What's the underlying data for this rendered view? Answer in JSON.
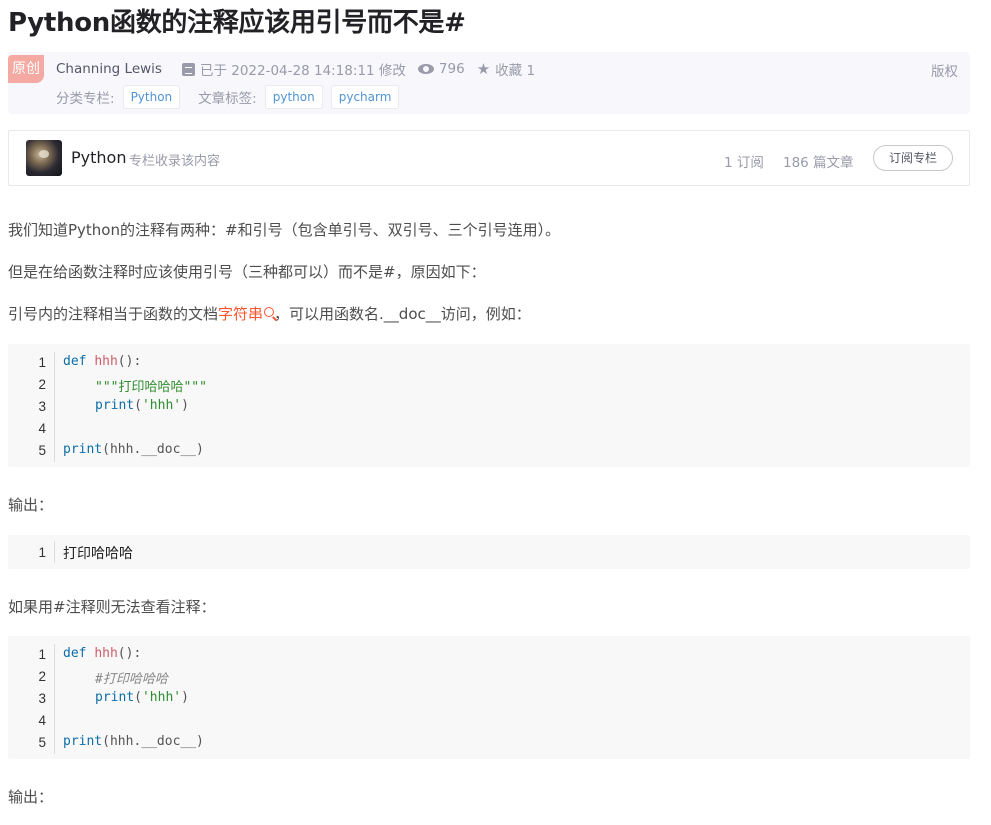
{
  "title": "Python函数的注释应该用引号而不是#",
  "meta": {
    "original_badge": "原创",
    "author": "Channing Lewis",
    "modified": "已于 2022-04-28 14:18:11 修改",
    "views": "796",
    "favorites": "收藏 1",
    "copyright": "版权",
    "category_label": "分类专栏:",
    "category_tag": "Python",
    "article_tags_label": "文章标签:",
    "article_tags": [
      "python",
      "pycharm"
    ]
  },
  "column": {
    "name": "Python",
    "desc": "专栏收录该内容",
    "subscriptions": "1 订阅",
    "articles": "186 篇文章",
    "subscribe_button": "订阅专栏"
  },
  "content": {
    "p1": "我们知道Python的注释有两种：#和引号（包含单引号、双引号、三个引号连用）。",
    "p2": "但是在给函数注释时应该使用引号（三种都可以）而不是#，原因如下：",
    "p3_before": "引号内的注释相当于函数的文档",
    "p3_link": "字符串",
    "p3_after": "，可以用函数名.__doc__访问，例如：",
    "output_label_1": "输出：",
    "p4": "如果用#注释则无法查看注释：",
    "output_label_2": "输出："
  },
  "code1": {
    "line_numbers": [
      "1",
      "2",
      "3",
      "4",
      "5"
    ],
    "l1_kw": "def",
    "l1_fn": "hhh",
    "l1_rest": "():",
    "l2_str": "\"\"\"打印哈哈哈\"\"\"",
    "l3_kw": "print",
    "l3_open": "(",
    "l3_str": "'hhh'",
    "l3_close": ")",
    "l5_kw": "print",
    "l5_rest": "(hhh.__doc__)"
  },
  "output1": {
    "line_numbers": [
      "1"
    ],
    "text": "打印哈哈哈"
  },
  "code2": {
    "line_numbers": [
      "1",
      "2",
      "3",
      "4",
      "5"
    ],
    "l1_kw": "def",
    "l1_fn": "hhh",
    "l1_rest": "():",
    "l2_cm": "#打印哈哈哈",
    "l3_kw": "print",
    "l3_open": "(",
    "l3_str": "'hhh'",
    "l3_close": ")",
    "l5_kw": "print",
    "l5_rest": "(hhh.__doc__)"
  },
  "colors": {
    "accent_link": "#fc5531",
    "tag_text": "#5094d5",
    "badge_bg": "#f4a9a2"
  }
}
